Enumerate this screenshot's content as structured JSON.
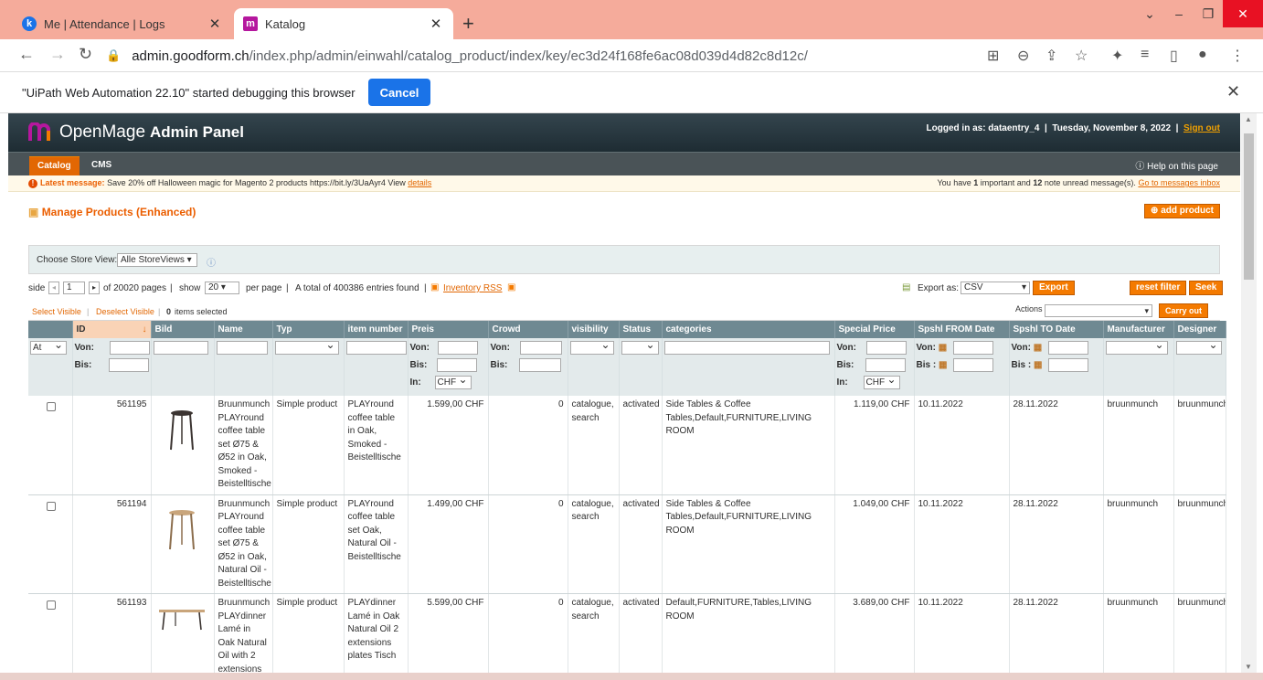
{
  "browser": {
    "tabs": [
      {
        "icon": "k",
        "title": "Me | Attendance | Logs",
        "color": "#1a73e8"
      },
      {
        "icon": "m",
        "title": "Katalog",
        "color": "#b5179e"
      }
    ],
    "url_host": "admin.goodform.ch",
    "url_path": "/index.php/admin/einwahl/catalog_product/index/key/ec3d24f168fe6ac08d039d4d82c8d12c/",
    "debug_text": "\"UiPath Web Automation 22.10\" started debugging this browser",
    "cancel_label": "Cancel"
  },
  "header": {
    "logo_text": "OpenMage",
    "logo_bold": "Admin Panel",
    "logged_in": "Logged in as: dataentry_4",
    "date": "Tuesday, November 8, 2022",
    "sign_out": "Sign out"
  },
  "nav": {
    "catalog": "Catalog",
    "cms": "CMS",
    "help": "Help on this page"
  },
  "message": {
    "label": "Latest message:",
    "text": "Save 20% off Halloween magic for Magento 2 products https://bit.ly/3UaAyr4 View",
    "link": "details",
    "right_prefix": "You have",
    "important": "1",
    "mid": "important and",
    "notes": "12",
    "suffix": "note unread message(s).",
    "inbox_link": "Go to messages inbox"
  },
  "page": {
    "title": "Manage Products (Enhanced)",
    "add_product": "add product",
    "store_label": "Choose Store View:",
    "store_value": "Alle StoreViews"
  },
  "pager": {
    "side": "side",
    "page": "1",
    "of_pages": "of 20020 pages",
    "show": "show",
    "per_page_value": "20",
    "per_page": "per page",
    "total": "A total of 400386 entries found",
    "rss": "Inventory RSS",
    "export_as": "Export as:",
    "export_value": "CSV",
    "export_btn": "Export",
    "reset_btn": "reset filter",
    "seek_btn": "Seek"
  },
  "mass": {
    "select_visible": "Select Visible",
    "deselect_visible": "Deselect Visible",
    "count": "0",
    "selected": "items selected",
    "actions": "Actions",
    "carry_out": "Carry out"
  },
  "columns": [
    "",
    "ID",
    "Bild",
    "Name",
    "Typ",
    "item number",
    "Preis",
    "Crowd",
    "visibility",
    "Status",
    "categories",
    "Special Price",
    "Spshl FROM Date",
    "Spshl TO Date",
    "Manufacturer",
    "Designer"
  ],
  "filters": {
    "at": "At",
    "von": "Von:",
    "bis": "Bis:",
    "bis2": "Bis :",
    "in": "In:",
    "currency": "CHF"
  },
  "rows": [
    {
      "id": "561195",
      "name": "Bruunmunch PLAYround coffee table set Ø75 & Ø52 in Oak, Smoked - Beistelltische",
      "type": "Simple product",
      "item": "PLAYround coffee table in Oak, Smoked - Beistelltische",
      "price": "1.599,00 CHF",
      "qty": "0",
      "visibility": "catalogue, search",
      "status": "activated",
      "categories": "Side Tables & Coffee Tables,Default,FURNITURE,LIVING ROOM",
      "special": "1.119,00 CHF",
      "from": "10.11.2022",
      "to": "28.11.2022",
      "manufacturer": "bruunmunch",
      "designer": "bruunmunch",
      "img": "tall-dark"
    },
    {
      "id": "561194",
      "name": "Bruunmunch PLAYround coffee table set Ø75 & Ø52 in Oak, Natural Oil - Beistelltische",
      "type": "Simple product",
      "item": "PLAYround coffee table set Oak, Natural Oil - Beistelltische",
      "price": "1.499,00 CHF",
      "qty": "0",
      "visibility": "catalogue, search",
      "status": "activated",
      "categories": "Side Tables & Coffee Tables,Default,FURNITURE,LIVING ROOM",
      "special": "1.049,00 CHF",
      "from": "10.11.2022",
      "to": "28.11.2022",
      "manufacturer": "bruunmunch",
      "designer": "bruunmunch",
      "img": "tall-light"
    },
    {
      "id": "561193",
      "name": "Bruunmunch PLAYdinner Lamé in Oak Natural Oil with 2 extensions",
      "type": "Simple product",
      "item": "PLAYdinner Lamé in Oak Natural Oil 2 extensions plates Tisch",
      "price": "5.599,00 CHF",
      "qty": "0",
      "visibility": "catalogue, search",
      "status": "activated",
      "categories": "Default,FURNITURE,Tables,LIVING ROOM",
      "special": "3.689,00 CHF",
      "from": "10.11.2022",
      "to": "28.11.2022",
      "manufacturer": "bruunmunch",
      "designer": "bruunmunch",
      "img": "long"
    }
  ]
}
